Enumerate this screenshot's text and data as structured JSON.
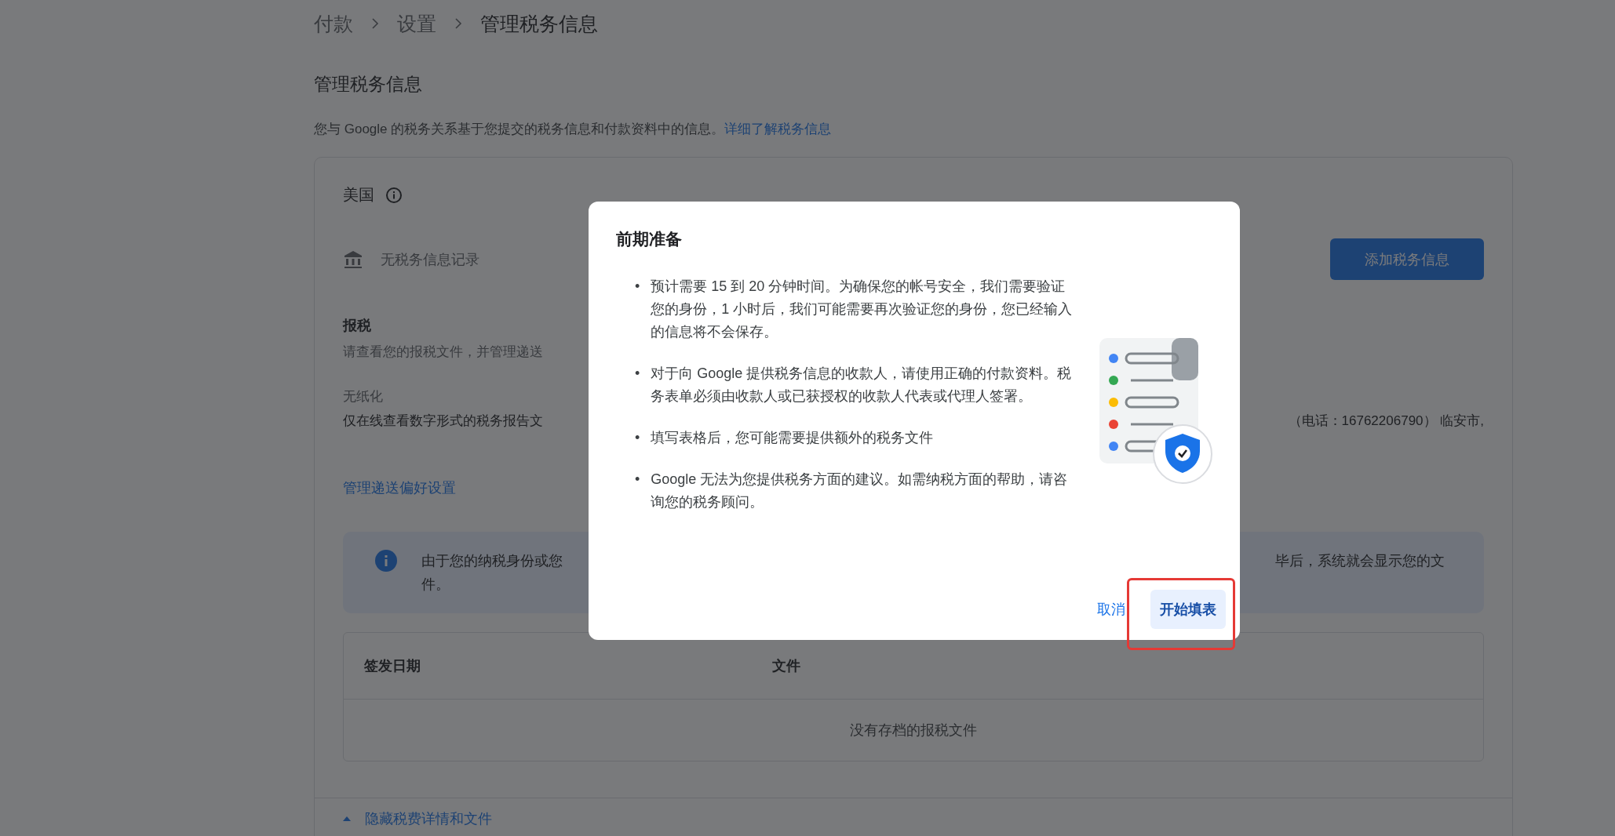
{
  "breadcrumb": [
    {
      "label": "付款",
      "current": false
    },
    {
      "label": "设置",
      "current": false
    },
    {
      "label": "管理税务信息",
      "current": true
    }
  ],
  "page_title": "管理税务信息",
  "description": {
    "text": "您与 Google 的税务关系基于您提交的税务信息和付款资料中的信息。",
    "link": "详细了解税务信息"
  },
  "card": {
    "country": "美国",
    "tax_record": "无税务信息记录",
    "add_button": "添加税务信息",
    "filing": {
      "heading": "报税",
      "text": "请查看您的报税文件，并管理递送"
    },
    "paperless": {
      "heading": "无纸化",
      "text_start": "仅在线查看数字形式的税务报告文",
      "text_end": "（电话：16762206790） 临安市,"
    },
    "manage_link": "管理递送偏好设置",
    "info_banner": {
      "line_1_start": "由于您的纳税身份或您",
      "line_1_end": "毕后，系统就会显示您的文",
      "line_2": "件。"
    },
    "table": {
      "columns": [
        "签发日期",
        "文件"
      ],
      "empty_text": "没有存档的报税文件"
    },
    "toggle": {
      "label": "隐藏税费详情和文件",
      "expanded": true
    }
  },
  "dialog": {
    "title": "前期准备",
    "bullets": [
      {
        "marker": "•",
        "text": "预计需要 15 到 20 分钟时间。为确保您的帐号安全，我们需要验证您的身份，1 小时后，我们可能需要再次验证您的身份，您已经输入的信息将不会保存。"
      },
      {
        "marker": "•",
        "text": "对于向 Google 提供税务信息的收款人，请使用正确的付款资料。税务表单必须由收款人或已获授权的收款人代表或代理人签署。"
      },
      {
        "marker": "•",
        "text": "填写表格后，您可能需要提供额外的税务文件"
      },
      {
        "marker": "•",
        "text": "Google 无法为您提供税务方面的建议。如需纳税方面的帮助，请咨询您的税务顾问。"
      }
    ],
    "illustration_dots": [
      {
        "color": "#4285f4"
      },
      {
        "color": "#34a853"
      },
      {
        "color": "#fbbc04"
      },
      {
        "color": "#ea4335"
      },
      {
        "color": "#4285f4"
      }
    ],
    "cancel": "取消",
    "start": "开始填表",
    "start_highlighted": true
  }
}
